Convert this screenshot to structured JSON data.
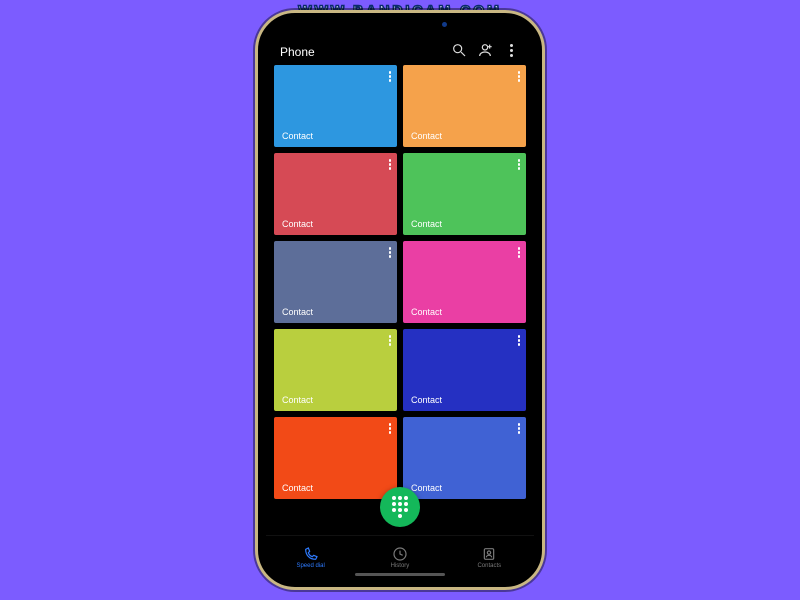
{
  "watermark": "WWW.BANDICAM.COM",
  "app": {
    "title": "Phone"
  },
  "tiles": [
    {
      "label": "Contact",
      "color": "#2d97e0"
    },
    {
      "label": "Contact",
      "color": "#f5a24b"
    },
    {
      "label": "Contact",
      "color": "#d64a55"
    },
    {
      "label": "Contact",
      "color": "#4ec35a"
    },
    {
      "label": "Contact",
      "color": "#5d6e99"
    },
    {
      "label": "Contact",
      "color": "#ea3fa4"
    },
    {
      "label": "Contact",
      "color": "#b9cf3e"
    },
    {
      "label": "Contact",
      "color": "#2530c2"
    },
    {
      "label": "Contact",
      "color": "#f24a17"
    },
    {
      "label": "Contact",
      "color": "#4062d4"
    }
  ],
  "nav": {
    "speed_dial": "Speed dial",
    "history": "History",
    "contacts": "Contacts"
  }
}
